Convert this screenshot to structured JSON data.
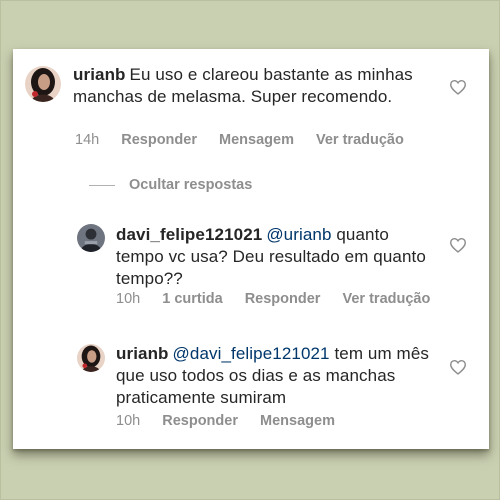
{
  "comments": [
    {
      "username": "urianb",
      "body": "Eu uso e clareou bastante as minhas manchas de melasma. Super recomendo.",
      "time": "14h",
      "reply_label": "Responder",
      "message_label": "Mensagem",
      "translate_label": "Ver tradução"
    }
  ],
  "replies_toggle": "Ocultar respostas",
  "replies": [
    {
      "username": "davi_felipe121021",
      "mention": "@urianb",
      "body": "quanto tempo vc usa? Deu resultado em quanto tempo??",
      "time": "10h",
      "likes_label": "1 curtida",
      "reply_label": "Responder",
      "translate_label": "Ver tradução"
    },
    {
      "username": "urianb",
      "mention": "@davi_felipe121021",
      "body": "tem um mês que uso todos os dias e as manchas praticamente sumiram",
      "time": "10h",
      "reply_label": "Responder",
      "message_label": "Mensagem"
    }
  ],
  "icons": {
    "like": "heart-outline-icon"
  },
  "colors": {
    "background": "#c9cfb1",
    "text": "#262626",
    "mention": "#00376b",
    "meta": "#8e8e8e"
  }
}
